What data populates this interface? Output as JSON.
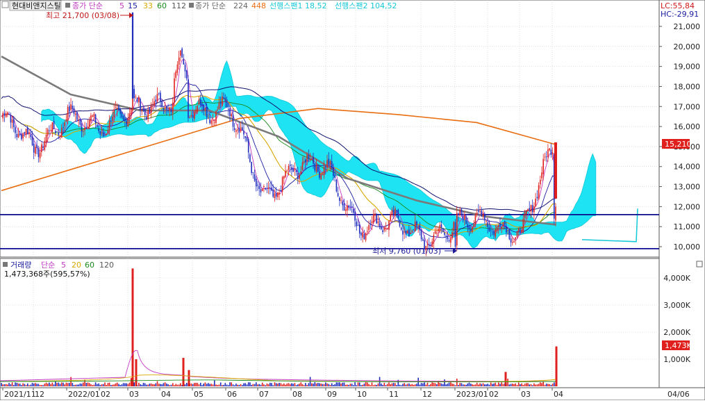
{
  "colors": {
    "up": "#e0201c",
    "down": "#1f2dbf",
    "ma5": "#c03ac0",
    "ma15": "#1a1aa0",
    "ma33": "#d8a800",
    "ma60": "#1a8a1a",
    "ma112": "#101070",
    "ma224": "#7a7a7a",
    "ma448": "#e86d10",
    "cloud": "#1ee3f2",
    "hline": "#0a0a90",
    "grid": "#c8c8c8",
    "frame": "#555555",
    "last_price_box": "#e0201c"
  },
  "header": {
    "name": "현대비앤지스틸",
    "ma_label": "종가 단순",
    "ma5": "5",
    "ma15": "15",
    "ma33": "33",
    "ma60": "60",
    "ma112": "112",
    "ma_long_label": "종가 단순",
    "ma224": "224",
    "ma448": "448",
    "span1": "선행스팬1 18,52",
    "span2": "선행스팬2 104,52",
    "lc": "LC:55,84",
    "hc": "HC:-29,91"
  },
  "volume_header": {
    "label": "거래량",
    "ma_label": "단순",
    "ma5": "5",
    "ma20": "20",
    "ma60": "60",
    "ma120": "120",
    "value": "1,473,368주(595,57%)"
  },
  "annotations": {
    "high": "최고 21,700 (03/08)",
    "low": "최저 9,760 (01/03)"
  },
  "price_axis": {
    "ticks": [
      "21,000",
      "20,000",
      "19,000",
      "18,000",
      "17,000",
      "16,000",
      "15,000",
      "14,000",
      "13,000",
      "12,000",
      "11,000",
      "10,000"
    ],
    "last": "15,210"
  },
  "volume_axis": {
    "ticks": [
      "4,000K",
      "3,000K",
      "2,000K",
      "1,000K"
    ],
    "last": "1,473K"
  },
  "x_axis": {
    "labels": [
      "2021/11",
      "12",
      "2022/01",
      "02",
      "03",
      "04",
      "05",
      "06",
      "07",
      "08",
      "09",
      "10",
      "11",
      "12",
      "2023/01",
      "02",
      "03",
      "04",
      "04/06"
    ]
  },
  "chart_data": {
    "type": "candlestick",
    "series": [
      {
        "name": "종가 단순 5",
        "values": []
      },
      {
        "name": "종가 단순 224",
        "values": []
      },
      {
        "name": "종가 단순 448",
        "values": []
      },
      {
        "name": "선행스팬1",
        "values": []
      },
      {
        "name": "선행스팬2",
        "values": []
      }
    ],
    "price_ylim": [
      9700,
      21500
    ],
    "volume_ylim": [
      0,
      4500000
    ],
    "high": {
      "value": 21700,
      "date": "03/08"
    },
    "low": {
      "value": 9760,
      "date": "01/03"
    },
    "last_close": 15210,
    "last_volume": 1473368,
    "horizontal_lines": [
      11600,
      9900
    ],
    "monthly_close": [
      {
        "x": "2021/11",
        "y": 16500
      },
      {
        "x": "12",
        "y": 14800
      },
      {
        "x": "2022/01",
        "y": 16800
      },
      {
        "x": "02",
        "y": 15500
      },
      {
        "x": "03",
        "y": 17300
      },
      {
        "x": "04",
        "y": 16800
      },
      {
        "x": "05",
        "y": 17100
      },
      {
        "x": "06",
        "y": 16900
      },
      {
        "x": "07",
        "y": 12400
      },
      {
        "x": "08",
        "y": 14100
      },
      {
        "x": "09",
        "y": 13700
      },
      {
        "x": "10",
        "y": 11200
      },
      {
        "x": "11",
        "y": 11000
      },
      {
        "x": "12",
        "y": 10600
      },
      {
        "x": "2023/01",
        "y": 11000
      },
      {
        "x": "02",
        "y": 11300
      },
      {
        "x": "03",
        "y": 10800
      },
      {
        "x": "04",
        "y": 15210
      }
    ],
    "ma448_curve": [
      {
        "x": "2021/11",
        "y": 12800
      },
      {
        "x": "2022/01",
        "y": 14000
      },
      {
        "x": "04",
        "y": 15200
      },
      {
        "x": "07",
        "y": 16400
      },
      {
        "x": "10",
        "y": 16900
      },
      {
        "x": "12",
        "y": 16600
      },
      {
        "x": "2023/01",
        "y": 16200
      },
      {
        "x": "04",
        "y": 15100
      }
    ],
    "ma224_curve": [
      {
        "x": "2021/11",
        "y": 19500
      },
      {
        "x": "2022/02",
        "y": 17600
      },
      {
        "x": "04",
        "y": 16800
      },
      {
        "x": "06",
        "y": 16800
      },
      {
        "x": "08",
        "y": 15500
      },
      {
        "x": "10",
        "y": 13400
      },
      {
        "x": "12",
        "y": 12300
      },
      {
        "x": "2023/02",
        "y": 11500
      },
      {
        "x": "04",
        "y": 11100
      }
    ]
  }
}
